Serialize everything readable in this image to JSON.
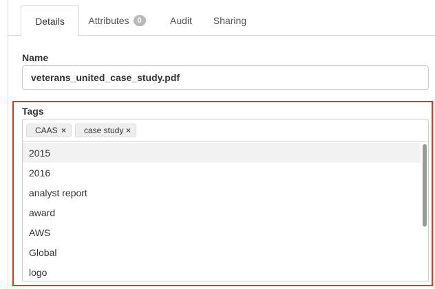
{
  "tabs": [
    {
      "label": "Details",
      "active": true
    },
    {
      "label": "Attributes",
      "badge": "0"
    },
    {
      "label": "Audit"
    },
    {
      "label": "Sharing"
    }
  ],
  "form": {
    "name_label": "Name",
    "name_value": "veterans_united_case_study.pdf",
    "tags_label": "Tags",
    "tags": [
      {
        "label": "CAAS",
        "remove": "×"
      },
      {
        "label": "case study",
        "remove": "×"
      }
    ],
    "options": [
      "2015",
      "2016",
      "analyst report",
      "award",
      "AWS",
      "Global",
      "logo"
    ]
  },
  "colors": {
    "highlight": "#e8341c",
    "badge": "#b9b9b9",
    "hover": "#f2f2f2"
  }
}
